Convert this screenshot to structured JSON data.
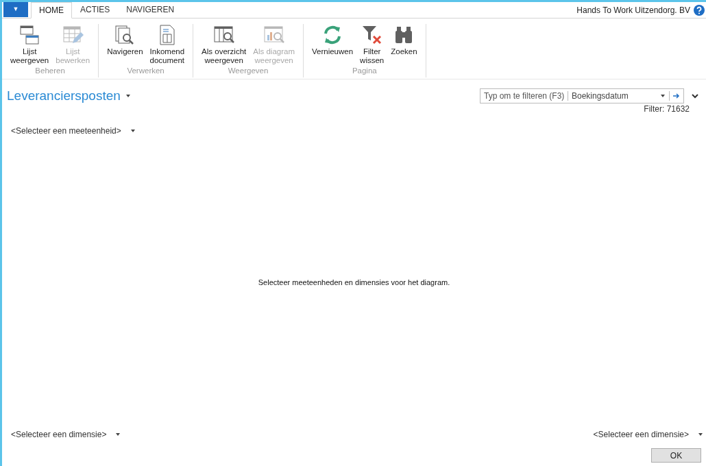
{
  "menu_button": {
    "glyph": "▼"
  },
  "tabs": [
    {
      "label": "HOME",
      "selected": true
    },
    {
      "label": "ACTIES",
      "selected": false
    },
    {
      "label": "NAVIGEREN",
      "selected": false
    }
  ],
  "company": "Hands To Work Uitzendorg. BV",
  "ribbon_groups": [
    {
      "label": "Beheren",
      "buttons": [
        {
          "kind": "windows",
          "label": [
            "Lijst",
            "weergeven"
          ],
          "disabled": false
        },
        {
          "kind": "edit-grid",
          "label": [
            "Lijst",
            "bewerken"
          ],
          "disabled": true
        }
      ]
    },
    {
      "label": "Verwerken",
      "buttons": [
        {
          "kind": "pages-search",
          "label": [
            "Navigeren"
          ],
          "disabled": false
        },
        {
          "kind": "document",
          "label": [
            "Inkomend",
            "document"
          ],
          "disabled": false
        }
      ]
    },
    {
      "label": "Weergeven",
      "buttons": [
        {
          "kind": "table-search",
          "label": [
            "Als overzicht",
            "weergeven"
          ],
          "disabled": false
        },
        {
          "kind": "chart-search",
          "label": [
            "Als diagram",
            "weergeven"
          ],
          "disabled": true
        }
      ]
    },
    {
      "label": "Pagina",
      "buttons": [
        {
          "kind": "refresh",
          "label": [
            "Vernieuwen"
          ],
          "disabled": false
        },
        {
          "kind": "filter-clear",
          "label": [
            "Filter",
            "wissen"
          ],
          "disabled": false
        },
        {
          "kind": "binoculars",
          "label": [
            "Zoeken"
          ],
          "disabled": false
        }
      ]
    }
  ],
  "page_title": "Leveranciersposten",
  "filter_box": {
    "placeholder": "Typ om te filteren (F3)",
    "field": "Boekingsdatum"
  },
  "filter_text": "Filter: 71632",
  "measure_select": "<Selecteer een meeteenheid>",
  "chart_message": "Selecteer meeteenheden en dimensies voor het diagram.",
  "dimension_left": "<Selecteer een dimensie>",
  "dimension_right": "<Selecteer een dimensie>",
  "ok_button": "OK"
}
